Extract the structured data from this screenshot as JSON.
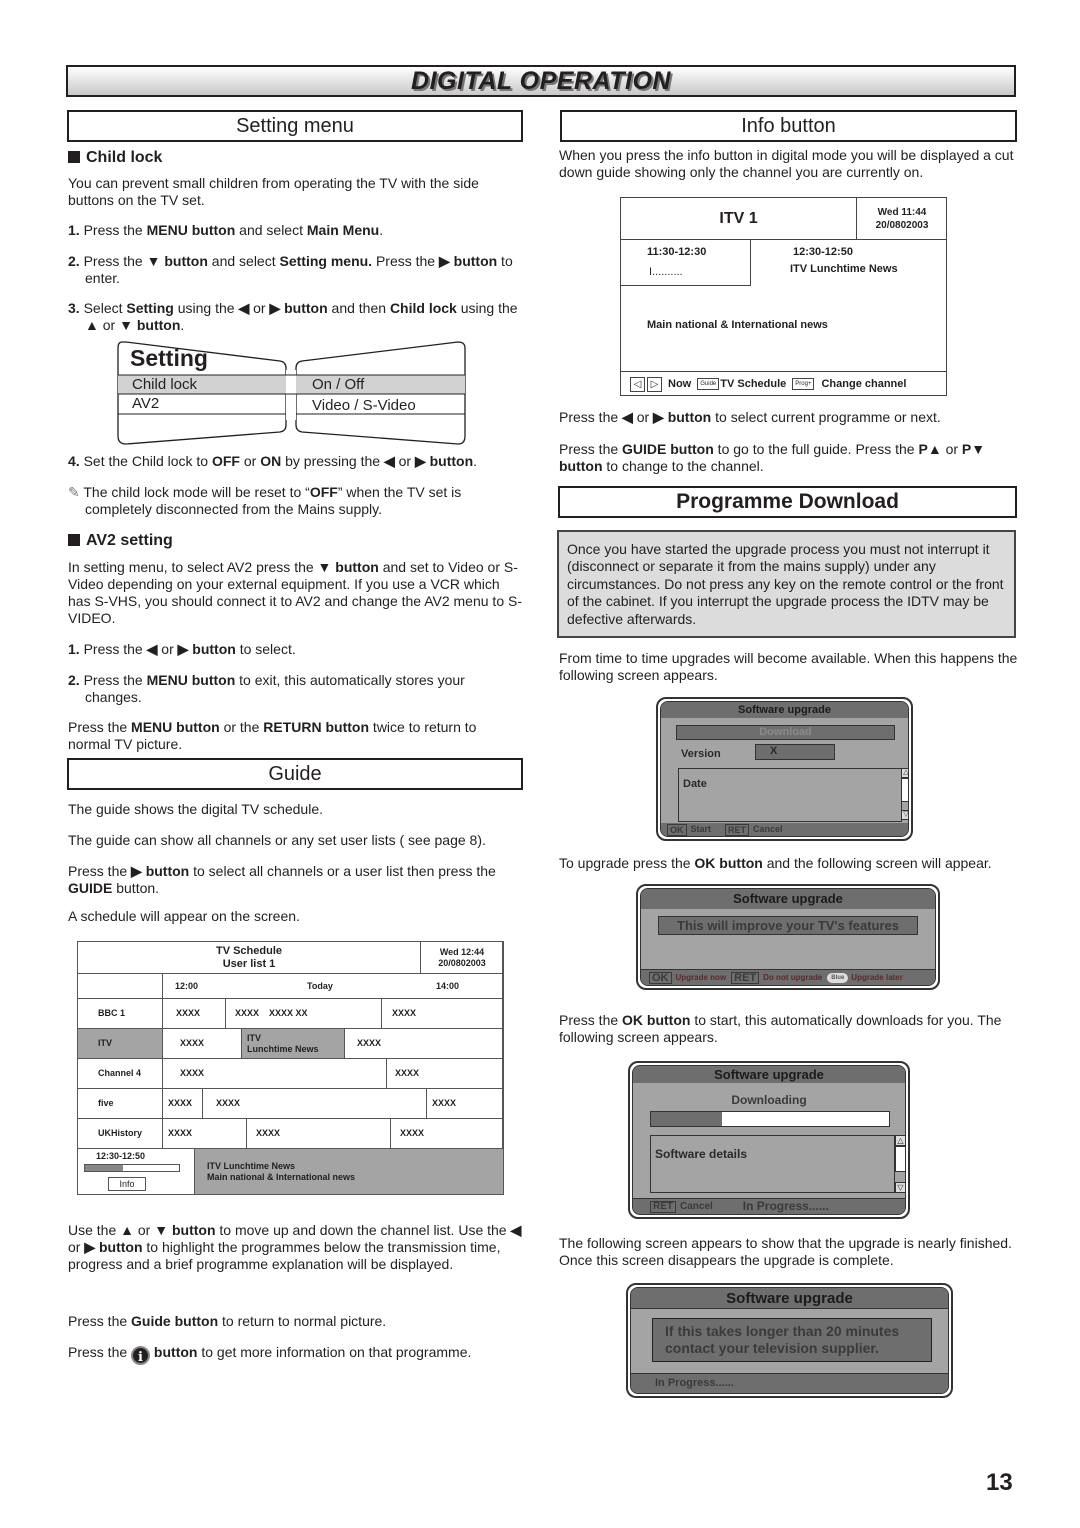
{
  "page": {
    "title": "DIGITAL OPERATION",
    "page_number": "13"
  },
  "setting_menu": {
    "heading": "Setting menu",
    "child_lock": {
      "subheading": "Child lock",
      "intro": "You can prevent small children from operating the TV with the side buttons on the TV set.",
      "steps": [
        {
          "num": "1.",
          "parts": [
            "Press the ",
            "MENU button",
            " and select ",
            "Main Menu",
            "."
          ]
        },
        {
          "num": "2.",
          "parts": [
            "Press the ",
            "▼ button",
            " and select ",
            "Setting menu.",
            " Press the ",
            "▶ button",
            " to enter."
          ]
        },
        {
          "num": "3.",
          "parts": [
            "Select ",
            "Setting",
            " using the ",
            "◀",
            " or ",
            "▶ button",
            " and then ",
            "Child lock",
            " using the ",
            "▲",
            " or ",
            "▼ button",
            "."
          ]
        },
        {
          "num": "4.",
          "parts": [
            "Set the Child lock to ",
            "OFF",
            " or ",
            "ON",
            " by pressing the ",
            "◀",
            " or ",
            "▶ button",
            "."
          ]
        }
      ],
      "note_icon": "pencil-note-icon",
      "note": [
        "The child lock mode will be reset to “",
        "OFF",
        "” when the TV set is completely disconnected from the Mains supply."
      ]
    },
    "setting_screen": {
      "title": "Setting",
      "rows": [
        {
          "label": "Child lock",
          "value": "On / Off",
          "highlighted": true
        },
        {
          "label": "AV2",
          "value": "Video / S-Video",
          "highlighted": false
        }
      ]
    },
    "av2": {
      "subheading": "AV2 setting",
      "intro": [
        "In setting menu, to select AV2 press the ",
        "▼ button",
        " and set to Video or S-Video depending on your external equipment. If you use a VCR which has S-VHS, you should connect it to AV2 and change the AV2 menu to S-VIDEO."
      ],
      "steps": [
        {
          "num": "1.",
          "parts": [
            "Press the ",
            "◀",
            " or ",
            "▶ button",
            " to select."
          ]
        },
        {
          "num": "2.",
          "parts": [
            "Press the ",
            "MENU button",
            " to exit, this automatically stores your changes."
          ]
        }
      ],
      "outro": [
        "Press the ",
        "MENU button",
        " or the ",
        "RETURN button",
        " twice to return to normal TV picture."
      ]
    }
  },
  "guide": {
    "heading": "Guide",
    "p1": "The guide shows the digital TV schedule.",
    "p2": "The guide can show all channels or any set user lists ( see page 8).",
    "p3": [
      "Press the ",
      "▶  button",
      " to select all channels or a user list then press the ",
      "GUIDE",
      " button."
    ],
    "p4": "A schedule will appear on the screen.",
    "schedule": {
      "title": "TV Schedule",
      "subtitle": "User list 1",
      "datetime_1": "Wed 12:44",
      "datetime_2": "20/0802003",
      "time_start": "12:00",
      "day": "Today",
      "time_end": "14:00",
      "channels": [
        {
          "name": "BBC 1",
          "programmes": [
            "XXXX",
            "XXXX    XXXX XX",
            "XXXX"
          ]
        },
        {
          "name": "ITV",
          "programmes": [
            "XXXX",
            "ITV\nLunchtime News",
            "XXXX"
          ],
          "selected": true
        },
        {
          "name": "Channel 4",
          "programmes": [
            "XXXX",
            "XXXX"
          ]
        },
        {
          "name": "five",
          "programmes": [
            "XXXX",
            "XXXX",
            "XXXX"
          ]
        },
        {
          "name": "UKHistory",
          "programmes": [
            "XXXX",
            "XXXX",
            "XXXX"
          ]
        }
      ],
      "detail_time": "12:30-12:50",
      "detail_progress": 0.4,
      "info_button": "Info",
      "detail_title": "ITV Lunchtime News",
      "detail_desc": "Main national & International news"
    },
    "p5": [
      "Use the ",
      "▲",
      " or ",
      "▼ button",
      " to move up and down the channel list. Use the ",
      "◀",
      " or ",
      "▶ button",
      " to highlight the programmes below the transmission time, progress and a brief programme explanation will be displayed."
    ],
    "p6": [
      "Press the ",
      "Guide button",
      " to return to normal picture."
    ],
    "p7_pre": "Press the",
    "p7_icon": "info-icon",
    "p7_bold": "button",
    "p7_post": "to get more information on that programme."
  },
  "info_button": {
    "heading": "Info button",
    "intro": "When you press the info button in digital mode you will be displayed a cut down guide showing only the channel you are currently on.",
    "screen": {
      "channel": "ITV 1",
      "datetime_1": "Wed 11:44",
      "datetime_2": "20/0802003",
      "now_time": "11:30-12:30",
      "now_title": "I..........",
      "next_time": "12:30-12:50",
      "next_title": "ITV Lunchtime News",
      "description": "Main national & International news",
      "footer": {
        "now": "Now",
        "guide_key": "Guide",
        "schedule": "TV Schedule",
        "prog_key": "Prog+",
        "change": "Change channel"
      }
    },
    "p1": [
      "Press the ",
      "◀",
      " or ",
      "▶ button",
      " to select current programme or next."
    ],
    "p2": [
      "Press the ",
      "GUIDE button",
      " to go to the full guide. Press the ",
      "P▲",
      " or ",
      "P▼",
      " ",
      "button",
      " to change to the channel."
    ]
  },
  "programme_download": {
    "heading": "Programme Download",
    "warning": "Once you have started the upgrade process you must not interrupt it (disconnect or separate it from the mains supply) under any circumstances. Do not press any key on the remote control or the front of the cabinet. If you interrupt the upgrade process the IDTV may be defective afterwards.",
    "p1": "From time to time upgrades will become available. When this happens the following screen appears.",
    "screen1": {
      "title": "Software upgrade",
      "download": "Download",
      "version_label": "Version",
      "version_value": "X",
      "date_label": "Date",
      "ok_key": "OK",
      "ok_label": "Start",
      "ret_key": "RET",
      "ret_label": "Cancel"
    },
    "p2": [
      "To upgrade press the ",
      "OK button",
      " and the following screen will appear."
    ],
    "screen2": {
      "title": "Software upgrade",
      "message": "This will improve your TV's features",
      "ok_key": "OK",
      "ok_label": "Upgrade now",
      "ret_key": "RET",
      "ret_label": "Do not upgrade",
      "blue_key": "Blue",
      "blue_label": "Upgrade later"
    },
    "p3": [
      "Press the ",
      "OK button",
      " to start, this automatically downloads for you. The following screen appears."
    ],
    "screen3": {
      "title": "Software upgrade",
      "status": "Downloading",
      "progress": 0.3,
      "details": "Software details",
      "ret_key": "RET",
      "ret_label": "Cancel",
      "in_progress": "In Progress......"
    },
    "p4": "The following screen appears to show that the upgrade is nearly finished. Once this screen disappears the upgrade is complete.",
    "screen4": {
      "title": "Software upgrade",
      "message_1": "If this takes longer than 20 minutes",
      "message_2": "contact your television supplier.",
      "in_progress": "In Progress......"
    }
  }
}
